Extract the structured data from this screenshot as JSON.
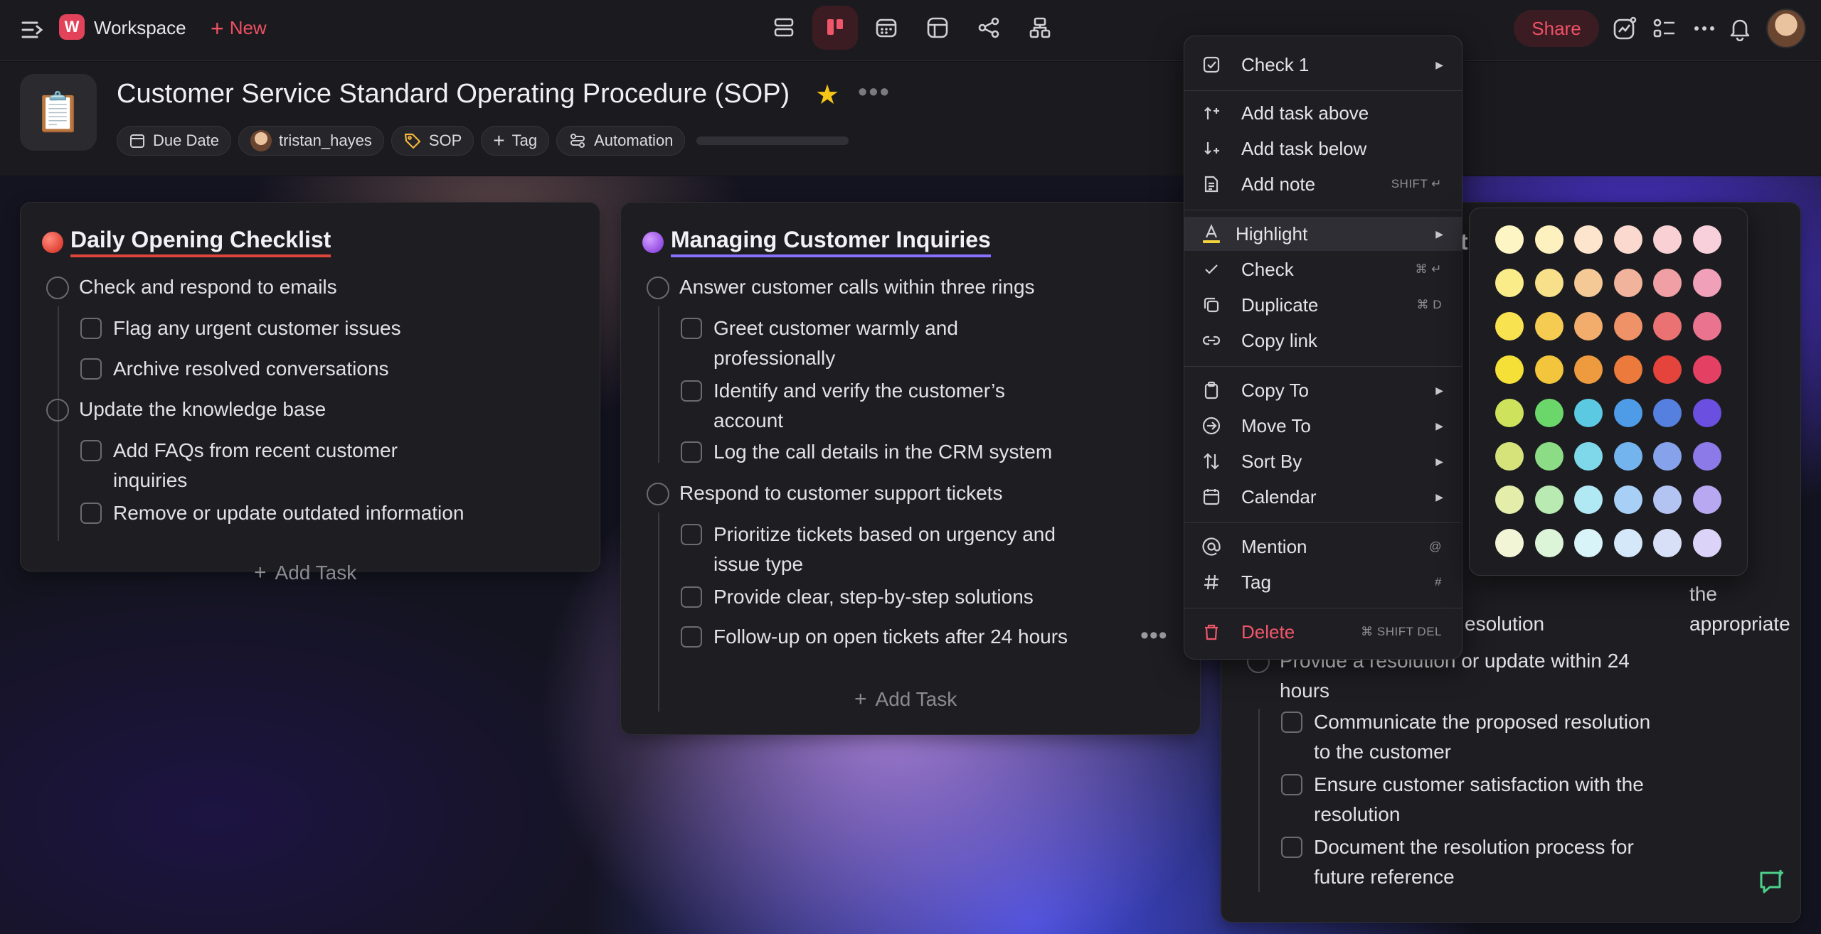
{
  "topbar": {
    "workspace_initial": "W",
    "workspace_name": "Workspace",
    "new_label": "New",
    "share_label": "Share",
    "view_icons": [
      "list-view-icon",
      "board-view-icon",
      "calendar-view-icon",
      "table-view-icon",
      "mindmap-view-icon",
      "org-view-icon"
    ],
    "active_view": "board-view-icon"
  },
  "header": {
    "doc_emoji": "📋",
    "title": "Customer Service Standard Operating Procedure (SOP)",
    "chips": {
      "due_date": "Due Date",
      "assignee": "tristan_hayes",
      "tag": "SOP",
      "add_tag": "Tag",
      "automation": "Automation"
    }
  },
  "cards": [
    {
      "title": "Daily Opening Checklist",
      "color": "#e0453c",
      "tasks": [
        {
          "text": "Check and respond to emails"
        },
        {
          "text": "Flag any urgent customer issues"
        },
        {
          "text": "Archive resolved conversations"
        },
        {
          "text": "Update the knowledge base"
        },
        {
          "text": "Add FAQs from recent customer"
        },
        {
          "text": "inquiries"
        },
        {
          "text": "Remove or update outdated information"
        }
      ],
      "add_task": "Add Task"
    },
    {
      "title": "Managing Customer Inquiries",
      "color": "#9a4cf0",
      "tasks": [
        {
          "text": "Answer customer calls within three rings"
        },
        {
          "text": "Greet customer warmly and"
        },
        {
          "text": "professionally"
        },
        {
          "text": "Identify and verify the customer’s"
        },
        {
          "text": "account"
        },
        {
          "text": "Log the call details in the CRM system"
        },
        {
          "text": "Respond to customer support tickets"
        },
        {
          "text": "Prioritize tickets based on urgency and"
        },
        {
          "text": "issue type"
        },
        {
          "text": "Provide clear, step-by-step solutions"
        },
        {
          "text": "Follow-up on open tickets after 24 hours"
        }
      ],
      "add_task": "Add Task"
    },
    {
      "title_partial": "t",
      "tasks": [
        {
          "text": "the appropriate"
        },
        {
          "text": "esolution"
        },
        {
          "text": "Provide a resolution or update within 24"
        },
        {
          "text": "hours"
        },
        {
          "text": "Communicate the proposed resolution"
        },
        {
          "text": "to the customer"
        },
        {
          "text": "Ensure customer satisfaction with the"
        },
        {
          "text": "resolution"
        },
        {
          "text": "Document the resolution process for"
        },
        {
          "text": "future reference"
        }
      ]
    }
  ],
  "context_menu": {
    "items": [
      {
        "label": "Check 1",
        "icon": "checkbox-icon",
        "submenu": true
      },
      {
        "label": "Add task above",
        "icon": "add-above-icon"
      },
      {
        "label": "Add task below",
        "icon": "add-below-icon"
      },
      {
        "label": "Add note",
        "icon": "note-icon",
        "shortcut": "SHIFT ↵"
      },
      {
        "label": "Highlight",
        "icon": "highlight-icon",
        "submenu": true
      },
      {
        "label": "Check",
        "icon": "check-icon",
        "shortcut": "⌘ ↵"
      },
      {
        "label": "Duplicate",
        "icon": "duplicate-icon",
        "shortcut": "⌘ D"
      },
      {
        "label": "Copy link",
        "icon": "link-icon"
      },
      {
        "label": "Copy To",
        "icon": "clipboard-icon",
        "submenu": true
      },
      {
        "label": "Move To",
        "icon": "move-icon",
        "submenu": true
      },
      {
        "label": "Sort By",
        "icon": "sort-icon",
        "submenu": true
      },
      {
        "label": "Calendar",
        "icon": "calendar-icon",
        "submenu": true
      },
      {
        "label": "Mention",
        "icon": "at-icon",
        "shortcut": "@"
      },
      {
        "label": "Tag",
        "icon": "hash-icon",
        "shortcut": "#"
      },
      {
        "label": "Delete",
        "icon": "trash-icon",
        "shortcut": "⌘ SHIFT DEL"
      }
    ]
  },
  "palette": {
    "rows": [
      [
        "#fdf5c4",
        "#fdf1c0",
        "#fde4cc",
        "#fcd9cf",
        "#f9d1d4",
        "#f8d0dc"
      ],
      [
        "#fbec8a",
        "#f8e08a",
        "#f5c996",
        "#f2b39c",
        "#f0a0a4",
        "#f0a0b8"
      ],
      [
        "#f8e250",
        "#f5cb52",
        "#f2ac6c",
        "#ef9268",
        "#ea7272",
        "#ea7490"
      ],
      [
        "#f4e036",
        "#f2c53c",
        "#ee9a3e",
        "#ec7a3c",
        "#e4443c",
        "#e44064"
      ],
      [
        "#cfe25c",
        "#6bd66a",
        "#5cc9e2",
        "#4e9ce8",
        "#5680e0",
        "#6a4fe0"
      ],
      [
        "#d6e27a",
        "#8cdc86",
        "#7fd8ea",
        "#74b4ee",
        "#86a2ea",
        "#8c7ae8"
      ],
      [
        "#e4edaa",
        "#b8eab2",
        "#b0e8f4",
        "#a8d0f6",
        "#b4c4f2",
        "#b8a8f2"
      ],
      [
        "#f2f6d6",
        "#dcf4d8",
        "#d8f4f8",
        "#d4e8fa",
        "#d8e0f8",
        "#dcd4f8"
      ]
    ]
  }
}
